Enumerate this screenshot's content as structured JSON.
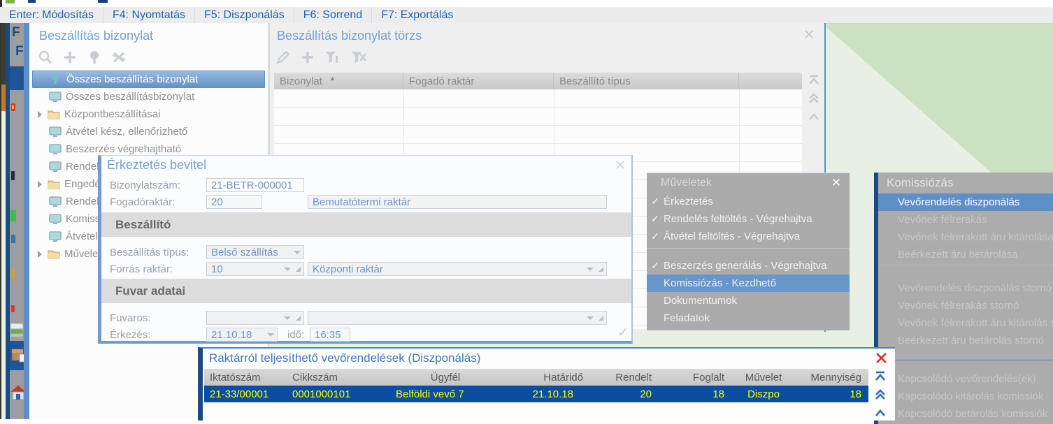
{
  "menubar": {
    "items": [
      "Enter: Módosítás",
      "F4: Nyomtatás",
      "F5: Diszponálás",
      "F6: Sorrend",
      "F7: Exportálás"
    ]
  },
  "left_stack": {
    "window_letter_1": "F",
    "window_letter_2": "F"
  },
  "left_panel": {
    "title": "Beszállítás bizonylat",
    "tree": [
      {
        "label": "Összes beszállítás bizonylat",
        "icon": "funnel-icon",
        "selected": true
      },
      {
        "label": "Összes beszállításbizonylat",
        "icon": "monitor-icon"
      },
      {
        "label": "Központbeszállításai",
        "icon": "folder-icon",
        "expandable": true
      },
      {
        "label": "Átvétel kész, ellenőrizhető",
        "icon": "monitor-icon"
      },
      {
        "label": "Beszerzés végrehajtható",
        "icon": "monitor-icon"
      },
      {
        "label": "Rendelé",
        "icon": "monitor-icon"
      },
      {
        "label": "Engedé",
        "icon": "folder-icon",
        "expandable": true
      },
      {
        "label": "Rendelt",
        "icon": "monitor-icon"
      },
      {
        "label": "Komiss",
        "icon": "monitor-icon"
      },
      {
        "label": "Átvétel",
        "icon": "monitor-icon"
      },
      {
        "label": "Művele",
        "icon": "folder-icon",
        "expandable": true
      }
    ]
  },
  "torzs_panel": {
    "title": "Beszállítás bizonylat törzs",
    "columns": [
      "Bizonylat",
      "Fogadó raktár",
      "Beszállító típus"
    ],
    "close_label": "✕"
  },
  "dialog": {
    "title": "Érkeztetés bevitel",
    "close_label": "✕",
    "confirm_check": "✓",
    "fields": {
      "bizonylatszam_label": "Bizonylatszám:",
      "bizonylatszam": "21-BETR-000001",
      "fogadoraktar_label": "Fogadóraktár:",
      "fogadoraktar_code": "20",
      "fogadoraktar_name": "Bemutatótermi raktár",
      "beszallito_section": "Beszállító",
      "beszallitas_tipus_label": "Beszállítás típus:",
      "beszallitas_tipus": "Belső szállítás",
      "forras_raktar_label": "Forrás raktár:",
      "forras_raktar_code": "10",
      "forras_raktar_name": "Központi raktár",
      "fuvar_section": "Fuvar adatai",
      "fuvaros_label": "Fuvaros:",
      "erkezes_label": "Érkezés:",
      "erkezes_datum": "21.10.18",
      "ido_label": "idő:",
      "ido": "16:35"
    }
  },
  "muveletek_panel": {
    "title": "Műveletek",
    "close_label": "✕",
    "check_glyph": "✓",
    "items": [
      {
        "label": "Érkeztetés",
        "checked": true
      },
      {
        "label": "Rendelés feltöltés - Végrehajtva",
        "checked": true
      },
      {
        "label": "Átvétel feltöltés - Végrehajtva",
        "checked": true
      },
      {
        "label": "Beszerzés generálás - Végrehajtva",
        "checked": true
      },
      {
        "label": "Komissiózás - Kezdhető",
        "selected": true
      },
      {
        "label": "Dokumentumok"
      },
      {
        "label": "Feladatok"
      }
    ]
  },
  "komissiozas_panel": {
    "title": "Komissiózás",
    "items": [
      {
        "label": "Vevőrendelés diszponálás",
        "selected": true
      },
      {
        "label": "Vevőnek félrerakás",
        "disabled": true
      },
      {
        "label": "Vevőnek félrerakott áru kitárolása",
        "disabled": true
      },
      {
        "label": "Beérkezett áru betárolása",
        "disabled": true
      },
      {
        "label": "Vevőrendelés diszponálás stornó",
        "disabled": true
      },
      {
        "label": "Vevőnek félrerakás stornó",
        "disabled": true
      },
      {
        "label": "Vevőnek félrerakott áru kitárolás stornó",
        "disabled": true
      },
      {
        "label": "Beérkezett áru betárolás stornó",
        "disabled": true
      },
      {
        "label": "Kapcsolódó vevőrendelés(ek)",
        "disabled": true
      },
      {
        "label": "Kapcsolódó kitárolás komissiók",
        "disabled": true
      },
      {
        "label": "Kapcsolódó betárolás komissiók",
        "disabled": true
      }
    ]
  },
  "bottom_panel": {
    "title": "Raktárról teljesíthető vevőrendelések (Diszponálás)",
    "columns": [
      "Iktatószám",
      "Cikkszám",
      "Ügyfél",
      "Határidő",
      "Rendelt",
      "Foglalt",
      "Művelet",
      "Mennyiség"
    ],
    "rows": [
      [
        "21-33/00001",
        "0001000101",
        "Belföldi vevő 7",
        "21.10.18",
        "20",
        "18",
        "Diszpo",
        "18"
      ]
    ],
    "selected_row_colors": {
      "background": "#0A4DA1",
      "text": "#FBFF00"
    }
  },
  "colors": {
    "accent_blue": "#5E8FC9",
    "navy": "#164B86",
    "title_blue": "#6FA0D6",
    "menu_blue": "#1E62B0",
    "panel_gray": "#ABABAB",
    "bg_green_light": "#E7F0E2",
    "bg_green_dark": "#CCE0C2",
    "close_red": "#D2321E"
  }
}
